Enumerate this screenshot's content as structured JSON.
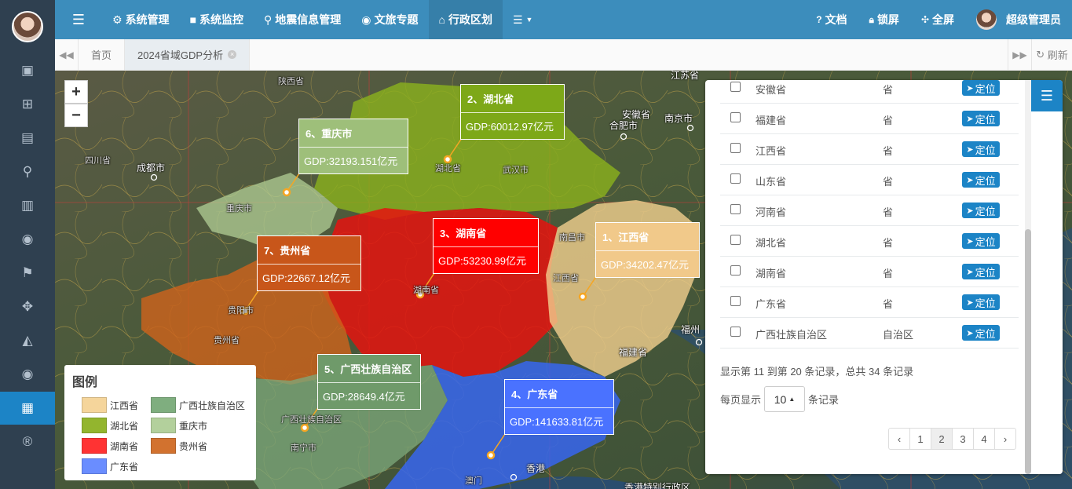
{
  "sidebar": {
    "icons": [
      "image-icon",
      "sitemap-icon",
      "map-icon",
      "map-marker-icon",
      "bar-chart-icon",
      "globe-icon",
      "flag-icon",
      "arrows-icon",
      "area-chart-icon",
      "globe-icon",
      "stats-icon",
      "registered-icon"
    ],
    "active_index": 10
  },
  "topbar": {
    "nav": [
      {
        "icon": "gear-icon",
        "label": "系统管理"
      },
      {
        "icon": "video-icon",
        "label": "系统监控"
      },
      {
        "icon": "map-marker-icon",
        "label": "地震信息管理"
      },
      {
        "icon": "globe-icon",
        "label": "文旅专题"
      },
      {
        "icon": "bank-icon",
        "label": "行政区划"
      }
    ],
    "active_nav": 4,
    "right": [
      {
        "icon": "question-icon",
        "label": "文档"
      },
      {
        "icon": "lock-icon",
        "label": "锁屏"
      },
      {
        "icon": "fullscreen-icon",
        "label": "全屏"
      }
    ],
    "user_name": "超级管理员"
  },
  "tabs": {
    "items": [
      {
        "label": "首页"
      },
      {
        "label": "2024省域GDP分析"
      }
    ],
    "active": 1,
    "refresh_label": "刷新"
  },
  "map": {
    "city_labels": [
      {
        "text": "陕西省",
        "dim": true
      },
      {
        "text": "四川省",
        "dim": true
      },
      {
        "text": "成都市",
        "dim": false
      },
      {
        "text": "安徽省",
        "dim": false
      },
      {
        "text": "合肥市",
        "dim": false
      },
      {
        "text": "南京市",
        "dim": false
      },
      {
        "text": "湖北省",
        "dim": true
      },
      {
        "text": "武汉市",
        "dim": true
      },
      {
        "text": "重庆市",
        "dim": true
      },
      {
        "text": "南昌市",
        "dim": true
      },
      {
        "text": "江西省",
        "dim": true
      },
      {
        "text": "湖南省",
        "dim": true
      },
      {
        "text": "贵阳市",
        "dim": true
      },
      {
        "text": "贵州省",
        "dim": true
      },
      {
        "text": "福州",
        "dim": false
      },
      {
        "text": "福建省",
        "dim": false
      },
      {
        "text": "广西壮族自治区",
        "dim": true
      },
      {
        "text": "南宁市",
        "dim": true
      },
      {
        "text": "澳门",
        "dim": true
      },
      {
        "text": "香港",
        "dim": false
      },
      {
        "text": "香港特别行政区",
        "dim": false
      },
      {
        "text": "江苏省",
        "dim": false
      }
    ],
    "popups": [
      {
        "rank_title": "2、湖北省",
        "gdp": "GDP:60012.97亿元",
        "color": "#7da818"
      },
      {
        "rank_title": "6、重庆市",
        "gdp": "GDP:32193.151亿元",
        "color": "#9ebf7a"
      },
      {
        "rank_title": "3、湖南省",
        "gdp": "GDP:53230.99亿元",
        "color": "#ff0000"
      },
      {
        "rank_title": "1、江西省",
        "gdp": "GDP:34202.47亿元",
        "color": "#f1c98a"
      },
      {
        "rank_title": "7、贵州省",
        "gdp": "GDP:22667.12亿元",
        "color": "#c8561a"
      },
      {
        "rank_title": "5、广西壮族自治区",
        "gdp": "GDP:28649.4亿元",
        "color": "#6f9a6a"
      },
      {
        "rank_title": "4、广东省",
        "gdp": "GDP:141633.81亿元",
        "color": "#4a72ff"
      }
    ],
    "legend": {
      "title": "图例",
      "items": [
        {
          "label": "江西省",
          "color": "#f5d59b"
        },
        {
          "label": "广西壮族自治区",
          "color": "#7fae7f"
        },
        {
          "label": "湖北省",
          "color": "#93b52e"
        },
        {
          "label": "重庆市",
          "color": "#b3d09c"
        },
        {
          "label": "湖南省",
          "color": "#ff3333"
        },
        {
          "label": "贵州省",
          "color": "#d2722f"
        },
        {
          "label": "广东省",
          "color": "#6a8dff"
        }
      ]
    }
  },
  "panel": {
    "rows": [
      {
        "name": "安徽省",
        "level": "省",
        "button": "定位"
      },
      {
        "name": "福建省",
        "level": "省",
        "button": "定位"
      },
      {
        "name": "江西省",
        "level": "省",
        "button": "定位"
      },
      {
        "name": "山东省",
        "level": "省",
        "button": "定位"
      },
      {
        "name": "河南省",
        "level": "省",
        "button": "定位"
      },
      {
        "name": "湖北省",
        "level": "省",
        "button": "定位"
      },
      {
        "name": "湖南省",
        "level": "省",
        "button": "定位"
      },
      {
        "name": "广东省",
        "level": "省",
        "button": "定位"
      },
      {
        "name": "广西壮族自治区",
        "level": "自治区",
        "button": "定位"
      }
    ],
    "info": "显示第 11 到第 20 条记录，总共 34 条记录",
    "page_size_prefix": "每页显示",
    "page_size": "10",
    "page_size_suffix": "条记录",
    "pages": [
      "‹",
      "1",
      "2",
      "3",
      "4",
      "›"
    ],
    "active_page": 2
  }
}
